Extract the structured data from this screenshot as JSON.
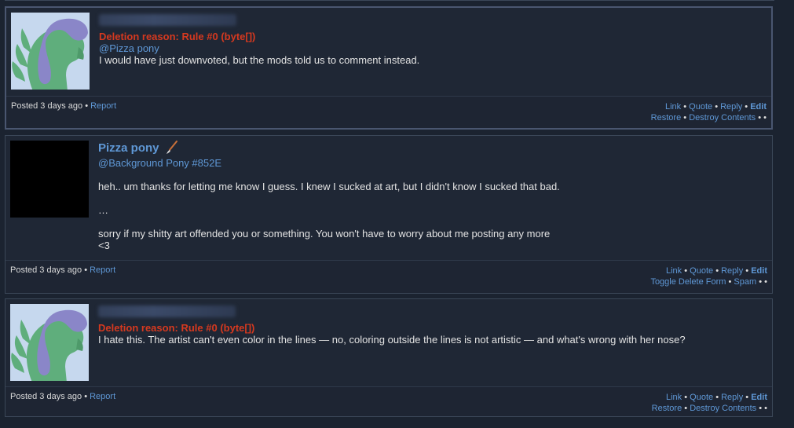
{
  "comments": [
    {
      "deletion_reason": "Deletion reason: Rule #0 (byte[])",
      "mention": "@Pizza pony",
      "text": "I would have just downvoted, but the mods told us to comment instead.",
      "posted": "Posted 3 days ago",
      "report": "Report",
      "actions": {
        "link": "Link",
        "quote": "Quote",
        "reply": "Reply",
        "edit": "Edit"
      },
      "actions2": {
        "restore": "Restore",
        "destroy": "Destroy Contents"
      },
      "avatar": "pony-silhouette-icon"
    },
    {
      "author": "Pizza pony",
      "mention": "@Background Pony #852E",
      "paragraphs": [
        "heh.. um thanks for letting me know I guess. I knew I sucked at art, but I didn't know I sucked that bad.",
        "…",
        "sorry if my shitty art offended you or something. You won't have to worry about me posting any more",
        "<3"
      ],
      "posted": "Posted 3 days ago",
      "report": "Report",
      "actions": {
        "link": "Link",
        "quote": "Quote",
        "reply": "Reply",
        "edit": "Edit"
      },
      "actions2": {
        "toggle": "Toggle Delete Form",
        "spam": "Spam"
      },
      "avatar": "black-avatar",
      "badge": "paintbrush-icon"
    },
    {
      "deletion_reason": "Deletion reason: Rule #0 (byte[])",
      "text": "I hate this. The artist can't even color in the lines — no, coloring outside the lines is not artistic — and what's wrong with her nose?",
      "posted": "Posted 3 days ago",
      "report": "Report",
      "actions": {
        "link": "Link",
        "quote": "Quote",
        "reply": "Reply",
        "edit": "Edit"
      },
      "actions2": {
        "restore": "Restore",
        "destroy": "Destroy Contents"
      },
      "avatar": "pony-silhouette-icon"
    }
  ],
  "colors": {
    "background": "#1b2330",
    "panel": "#1f2735",
    "link": "#5f98d6",
    "deletion": "#d6391f"
  }
}
